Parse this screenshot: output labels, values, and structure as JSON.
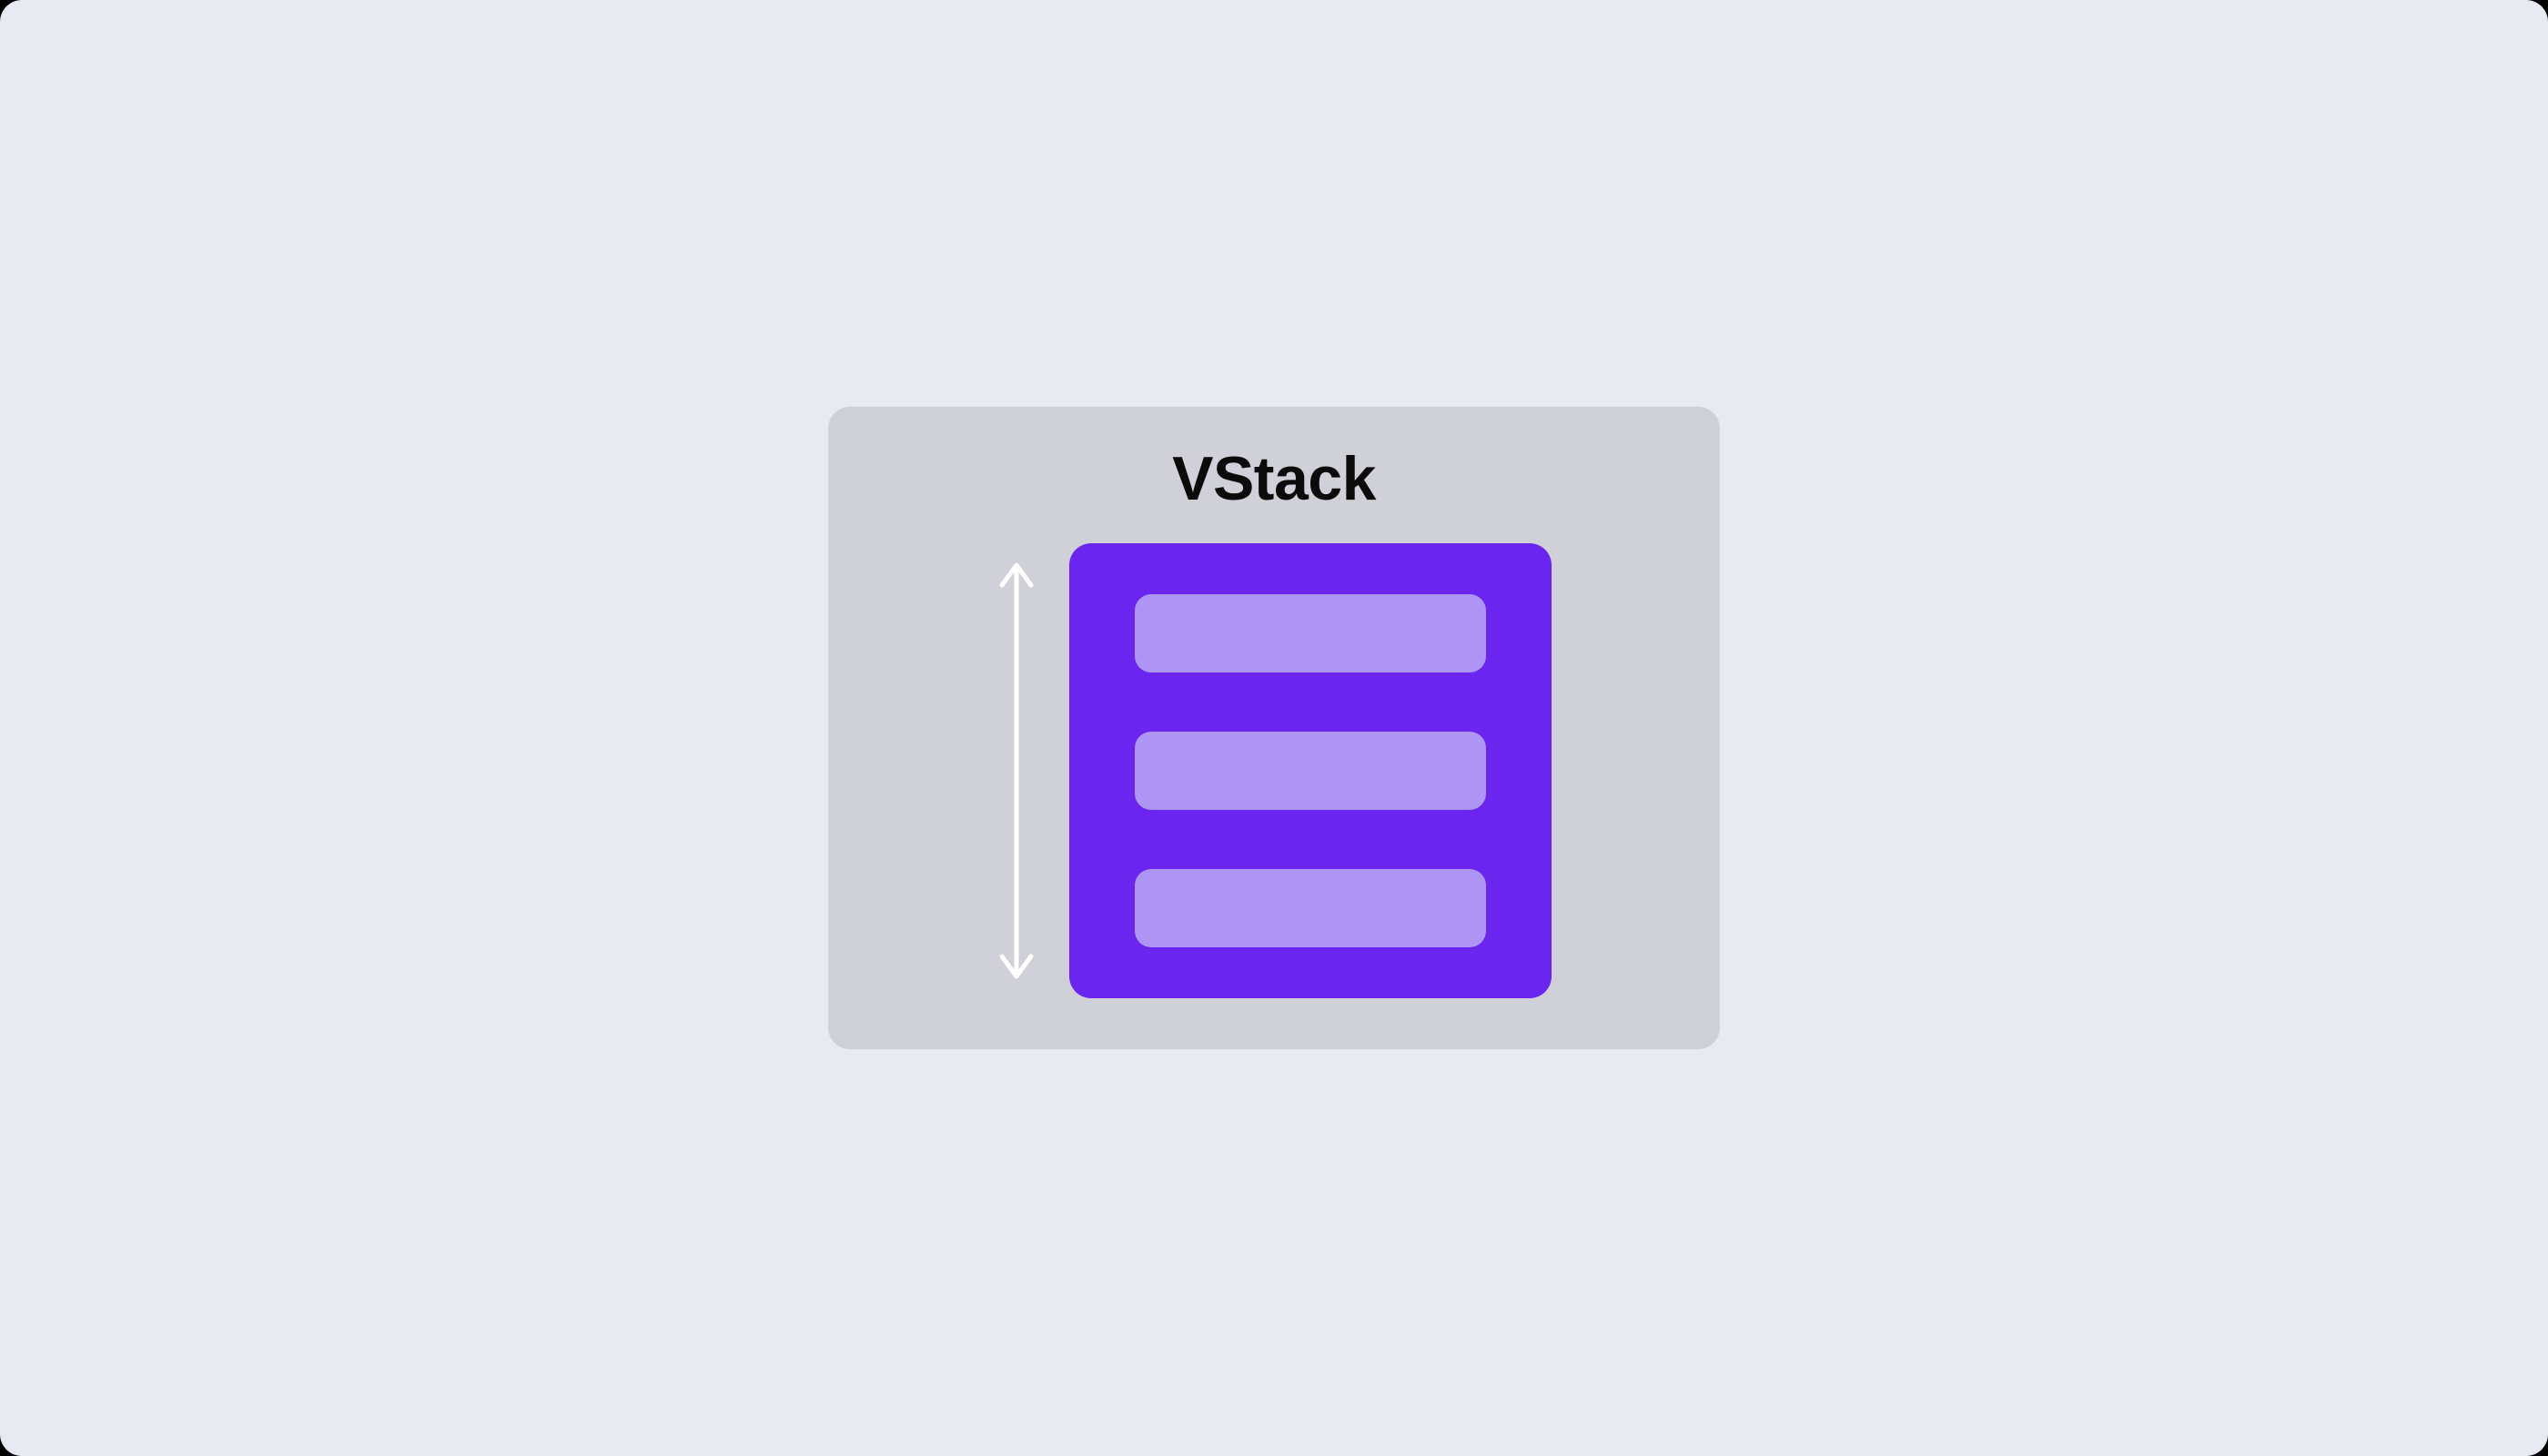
{
  "diagram": {
    "title": "VStack",
    "item_count": 3,
    "colors": {
      "page_bg": "#e7eaf1",
      "panel_bg": "#cfd0d8",
      "stack_bg": "#6a26ef",
      "item_bg": "#af95f4",
      "arrow": "#ffffff",
      "title": "#0b0b0c"
    },
    "arrow_direction": "vertical"
  }
}
